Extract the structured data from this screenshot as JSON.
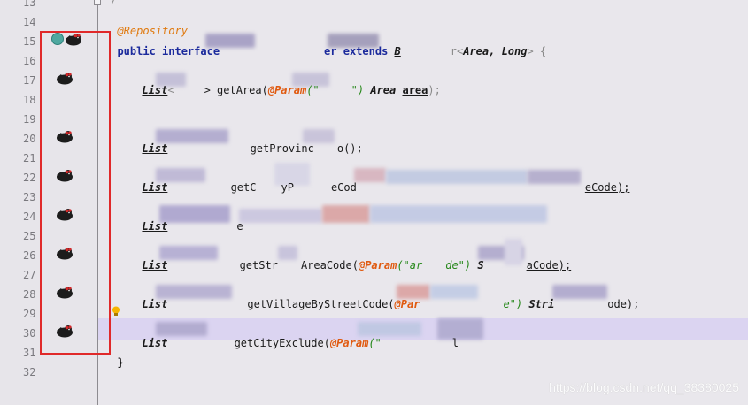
{
  "editor": {
    "line_numbers": [
      "13",
      "14",
      "15",
      "16",
      "17",
      "18",
      "19",
      "20",
      "21",
      "22",
      "23",
      "24",
      "25",
      "26",
      "27",
      "28",
      "29",
      "30",
      "31",
      "32"
    ],
    "code": {
      "l13": "*/",
      "l14_anno": "@Repository",
      "l15_kw1": "public interface",
      "l15_name_tail": "er",
      "l15_kw2": "extends",
      "l15_base": "B",
      "l15_generic_open": "r<",
      "l15_args": "Area, Long",
      "l15_generic_close": "> {",
      "l17_list": "List",
      "l17_gen": "<",
      "l17_gen2": "> getArea(",
      "l17_param": "@Param",
      "l17_str": "(\"",
      "l17_str2": "\") ",
      "l17_type": "Area",
      "l17_arg": "area",
      "l17_end": ");",
      "l20_list": "List",
      "l20_method": " getProvinc",
      "l20_end": "o();",
      "l22_list": "List",
      "l22_method": " getC",
      "l22_mid": "yP",
      "l22_mid2": "eCod",
      "l22_tail": "eCode);",
      "l24_list": "List",
      "l24_mid": "e",
      "l26_list": "List",
      "l26_method": " getStr",
      "l26_mid": "AreaCode(",
      "l26_param": "@Param",
      "l26_str": "(\"ar",
      "l26_str2": "de\") ",
      "l26_type": "S",
      "l26_tail": "aCode);",
      "l28_list": "List",
      "l28_method": "getVillageByStreetCode(",
      "l28_param": "@Par",
      "l28_str": "e\") ",
      "l28_type": "Stri",
      "l28_tail": "ode);",
      "l30_list": "List",
      "l30_method": " getCityExclude(",
      "l30_param": "@Param",
      "l30_str": "(\"",
      "l30_tail": "l",
      "l31": "}"
    }
  },
  "icons": {
    "gutter_marker": "mybatis-bird-icon",
    "implemented_marker": "interface-implemented-icon",
    "intention": "lightbulb-icon"
  },
  "colors": {
    "annotation_box": "#e0292a",
    "current_line": "#dbd4f1",
    "keyword": "#1b2a9c",
    "annotation": "#e07a10"
  },
  "watermark": "https://blog.csdn.net/qq_38380025"
}
